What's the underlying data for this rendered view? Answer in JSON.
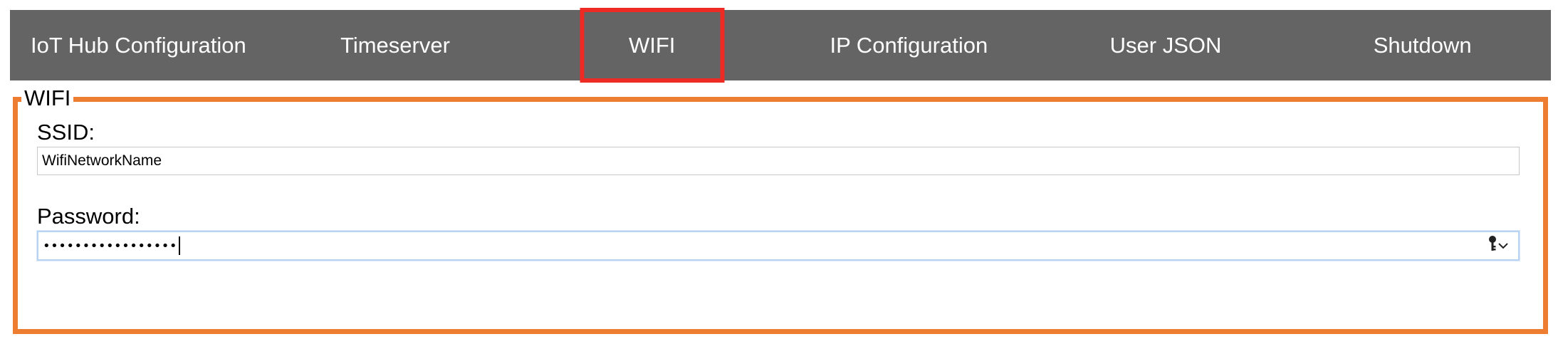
{
  "nav": {
    "items": [
      {
        "label": "IoT Hub Configuration"
      },
      {
        "label": "Timeserver"
      },
      {
        "label": "WIFI"
      },
      {
        "label": "IP Configuration"
      },
      {
        "label": "User JSON"
      },
      {
        "label": "Shutdown"
      }
    ],
    "active": "WIFI"
  },
  "wifi": {
    "legend": "WIFI",
    "ssid_label": "SSID:",
    "ssid_value": "WifiNetworkName",
    "password_label": "Password:",
    "password_masked": "•••••••••••••••••"
  },
  "colors": {
    "nav_bg": "#646464",
    "active_border": "#ee2a24",
    "fieldset_border": "#ed7d31",
    "focus_border": "#b9d4f3"
  },
  "icons": {
    "password_control": "key-icon",
    "password_dropdown": "chevron-down-icon"
  }
}
